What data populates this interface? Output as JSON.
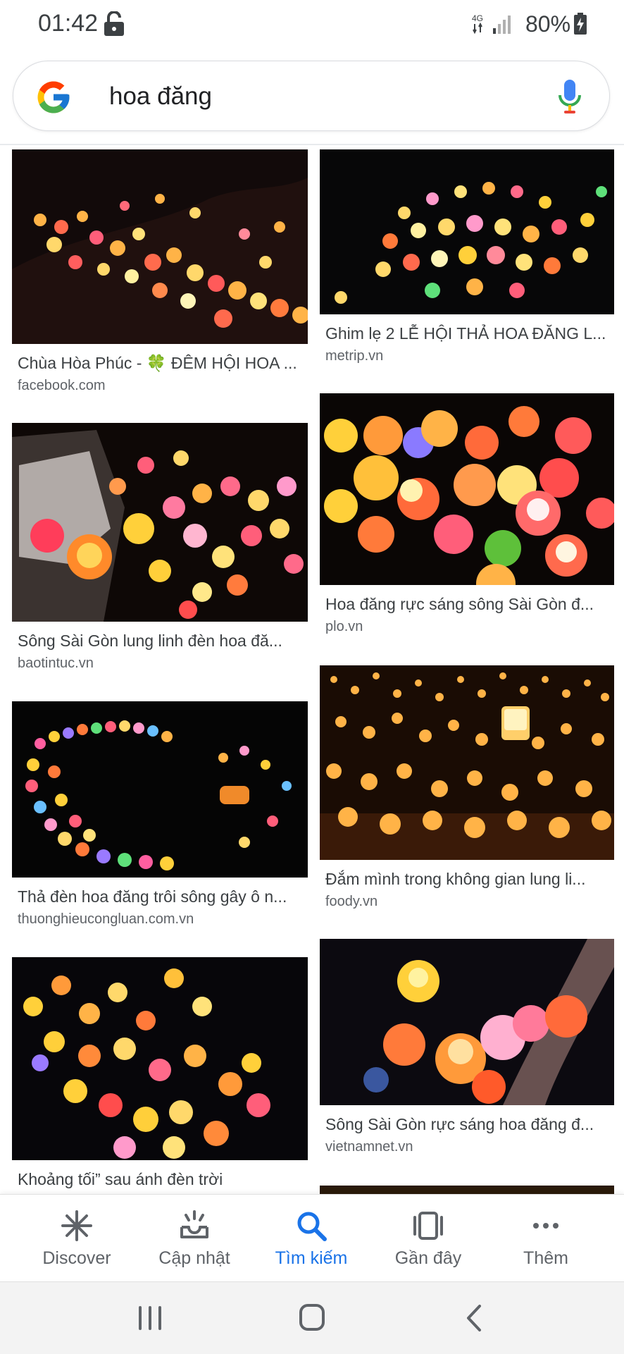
{
  "status_bar": {
    "time": "01:42",
    "network": "4G",
    "battery": "80%"
  },
  "search": {
    "query": "hoa đăng"
  },
  "results": [
    {
      "title": "Chùa Hòa Phúc - 🍀 ĐÊM HỘI HOA ...",
      "source": "facebook.com"
    },
    {
      "title": "Ghim lẹ 2 LỄ HỘI THẢ HOA ĐĂNG L...",
      "source": "metrip.vn"
    },
    {
      "title": "Sông Sài Gòn lung linh đèn hoa đă...",
      "source": "baotintuc.vn"
    },
    {
      "title": "Hoa đăng rực sáng sông Sài Gòn đ...",
      "source": "plo.vn"
    },
    {
      "title": "Thả đèn hoa đăng trôi sông gây ô n...",
      "source": "thuonghieucongluan.com.vn"
    },
    {
      "title": "Đắm mình trong không gian lung li...",
      "source": "foody.vn"
    },
    {
      "title": "Khoảng tối” sau ánh đèn trời",
      "source": ""
    },
    {
      "title": "Sông Sài Gòn rực sáng hoa đăng đ...",
      "source": "vietnamnet.vn"
    }
  ],
  "bottom_nav": [
    {
      "label": "Discover",
      "icon": "asterisk-icon"
    },
    {
      "label": "Cập nhật",
      "icon": "inbox-updates-icon"
    },
    {
      "label": "Tìm kiếm",
      "icon": "search-icon"
    },
    {
      "label": "Gần đây",
      "icon": "recent-cards-icon"
    },
    {
      "label": "Thêm",
      "icon": "more-dots-icon"
    }
  ],
  "colors": {
    "active": "#1a73e8",
    "inactive": "#5f6368"
  }
}
